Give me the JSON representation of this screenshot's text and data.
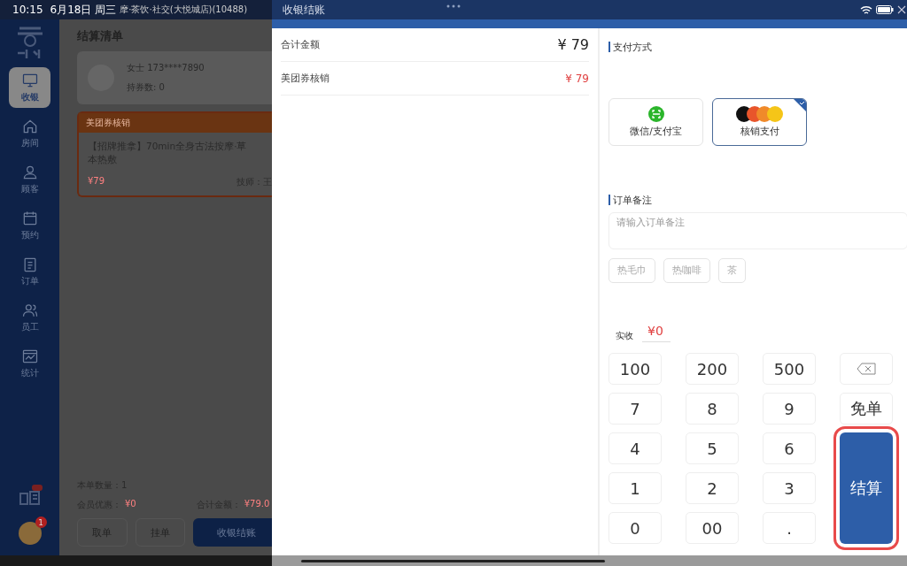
{
  "status_bar": {
    "time": "10:15",
    "date": "6月18日 周三",
    "store": "摩·茶饮·社交(大悦城店)(10488)"
  },
  "sidebar": {
    "items": [
      {
        "label": "收银",
        "selected": true
      },
      {
        "label": "房间",
        "selected": false
      },
      {
        "label": "顾客",
        "selected": false
      },
      {
        "label": "预约",
        "selected": false
      },
      {
        "label": "订单",
        "selected": false
      },
      {
        "label": "员工",
        "selected": false
      },
      {
        "label": "统计",
        "selected": false
      }
    ],
    "notification_count": "1"
  },
  "order": {
    "title": "结算清单",
    "customer": {
      "name": "女士 173****7890",
      "coupons": "持券数: 0"
    },
    "coupon": {
      "header": "美团券核销",
      "title": "【招牌推拿】70min全身古法按摩·草本热敷",
      "price": "¥79",
      "staff": "技师：王"
    },
    "quantity": "本单数量：1",
    "discount_label": "会员优惠：",
    "discount": "¥0",
    "total_label": "合计金额：",
    "total": "¥79.0",
    "buttons": [
      {
        "label": "取单",
        "kind": "plain"
      },
      {
        "label": "挂单",
        "kind": "plain"
      },
      {
        "label": "收银结账",
        "kind": "primary"
      }
    ]
  },
  "checkout": {
    "title": "收银结账",
    "summary": [
      {
        "label": "合计金额",
        "value": "¥ 79",
        "kind": "total"
      },
      {
        "label": "美团券核销",
        "value": "¥ 79",
        "kind": "deduction"
      }
    ],
    "payment_heading": "支付方式",
    "payment_methods": [
      {
        "label": "微信/支付宝",
        "kind": "scan",
        "selected": false
      },
      {
        "label": "核销支付",
        "kind": "voucher",
        "selected": true
      }
    ],
    "note_heading": "订单备注",
    "note_placeholder": "请输入订单备注",
    "note_tags": [
      "热毛巾",
      "热咖啡",
      "茶"
    ],
    "received_label": "实收",
    "received_value": "¥0",
    "keypad": [
      "100",
      "200",
      "500",
      "7",
      "8",
      "9",
      "4",
      "5",
      "6",
      "1",
      "2",
      "3",
      "0",
      "00",
      "."
    ],
    "side_keys": [
      {
        "label": "免单",
        "kind": "key"
      },
      {
        "label": "结算",
        "kind": "submit"
      }
    ]
  }
}
